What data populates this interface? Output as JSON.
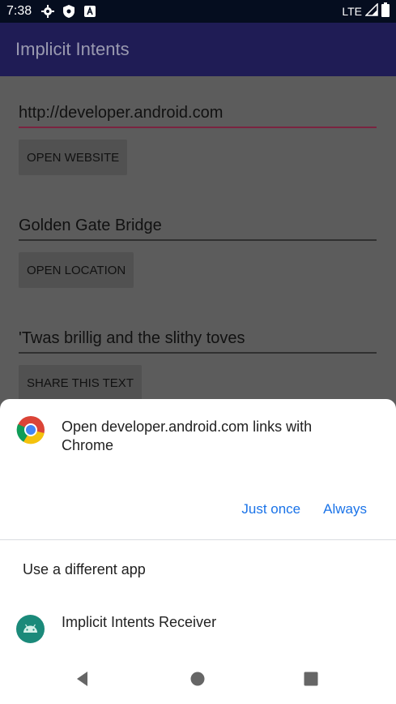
{
  "status_bar": {
    "time": "7:38",
    "network": "LTE",
    "icons": [
      "gear-icon",
      "shield-icon",
      "notification-a-icon",
      "signal-icon",
      "battery-icon"
    ]
  },
  "app_bar": {
    "title": "Implicit Intents"
  },
  "main": {
    "website_field": "http://developer.android.com",
    "open_website_label": "OPEN WEBSITE",
    "location_field": "Golden Gate Bridge",
    "open_location_label": "OPEN LOCATION",
    "share_field": "'Twas brillig and the slithy toves",
    "share_text_label": "SHARE THIS TEXT"
  },
  "chooser": {
    "title": "Open developer.android.com links with Chrome",
    "just_once_label": "Just once",
    "always_label": "Always",
    "different_app_label": "Use a different app",
    "receiver_label": "Implicit Intents Receiver"
  },
  "colors": {
    "status_bar": "#050d1f",
    "app_bar": "#1f1c55",
    "accent": "#1a73e8",
    "scrim": "#5c5c5c"
  }
}
